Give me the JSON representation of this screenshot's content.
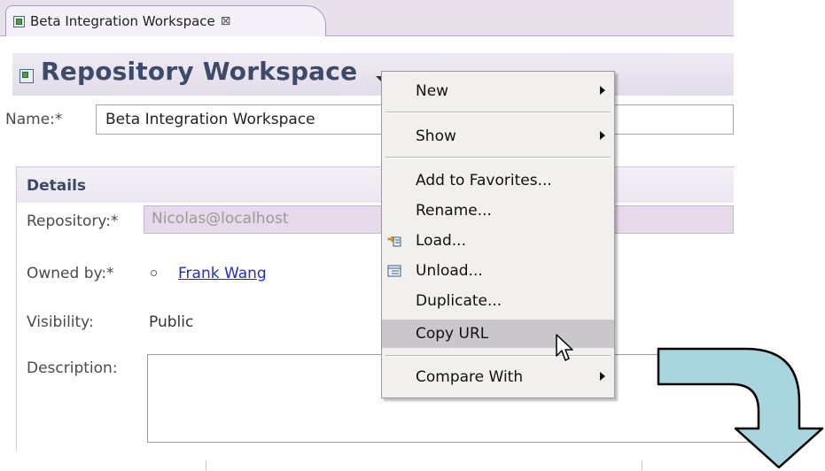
{
  "editor_tab": {
    "label": "Beta Integration Workspace",
    "close_glyph": "⊠"
  },
  "header": {
    "title": "Repository Workspace"
  },
  "name_field": {
    "label": "Name:*",
    "value": "Beta Integration Workspace"
  },
  "details": {
    "title": "Details",
    "repository_label": "Repository:*",
    "repository_value": "Nicolas@localhost",
    "owned_by_label": "Owned by:*",
    "owned_by_value": "Frank Wang",
    "visibility_label": "Visibility:",
    "visibility_value": "Public",
    "description_label": "Description:",
    "description_value": ""
  },
  "context_menu": {
    "items": [
      {
        "label": "New",
        "submenu": true
      },
      {
        "label": "Show",
        "submenu": true
      },
      {
        "label": "Add to Favorites..."
      },
      {
        "label": "Rename..."
      },
      {
        "label": "Load...",
        "icon": "load-icon"
      },
      {
        "label": "Unload...",
        "icon": "unload-icon"
      },
      {
        "label": "Duplicate..."
      },
      {
        "label": "Copy URL",
        "highlighted": true
      },
      {
        "label": "Compare With",
        "submenu": true
      }
    ]
  },
  "colors": {
    "accent_title": "#3e4a6a",
    "link": "#1f2fbf",
    "arrow_fill": "#a9d5df",
    "menu_highlight": "#c9c7cc"
  }
}
